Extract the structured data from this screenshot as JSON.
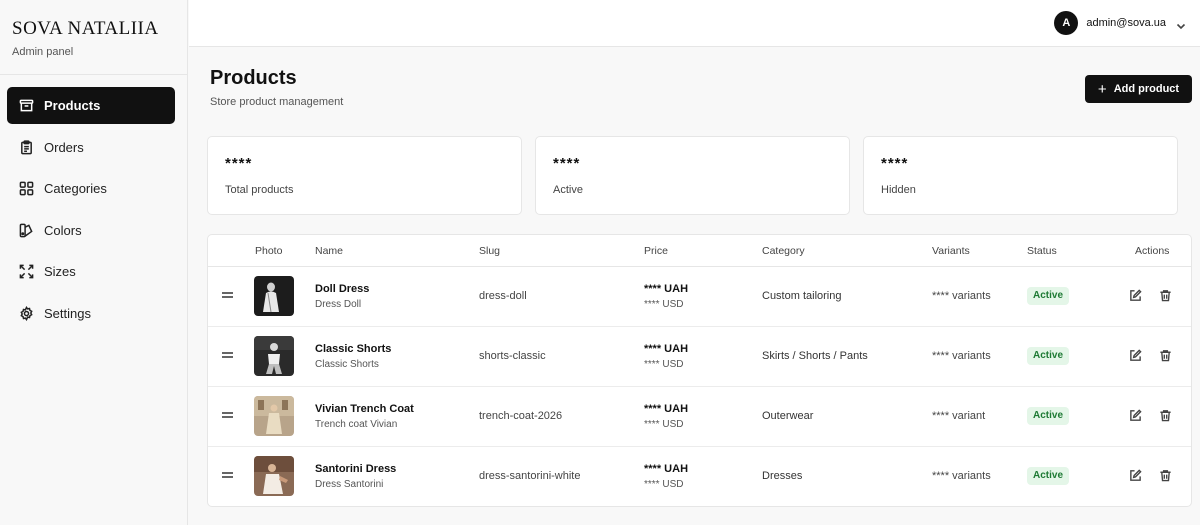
{
  "brand": {
    "title": "SOVA NATALIIA",
    "subtitle": "Admin panel"
  },
  "sidebar": {
    "items": [
      {
        "label": "Products",
        "icon": "archive-icon",
        "active": true
      },
      {
        "label": "Orders",
        "icon": "clipboard-icon",
        "active": false
      },
      {
        "label": "Categories",
        "icon": "grid-icon",
        "active": false
      },
      {
        "label": "Colors",
        "icon": "palette-icon",
        "active": false
      },
      {
        "label": "Sizes",
        "icon": "expand-icon",
        "active": false
      },
      {
        "label": "Settings",
        "icon": "gear-icon",
        "active": false
      }
    ]
  },
  "topbar": {
    "avatar_initial": "A",
    "email": "admin@sova.ua"
  },
  "header": {
    "title": "Products",
    "subtitle": "Store product management",
    "add_label": "Add product"
  },
  "stats": [
    {
      "value": "****",
      "label": "Total products"
    },
    {
      "value": "****",
      "label": "Active"
    },
    {
      "value": "****",
      "label": "Hidden"
    }
  ],
  "table": {
    "columns": [
      "Photo",
      "Name",
      "Slug",
      "Price",
      "Category",
      "Variants",
      "Status",
      "Actions"
    ],
    "rows": [
      {
        "name": "Doll Dress",
        "subname": "Dress Doll",
        "slug": "dress-doll",
        "price_uah": "**** UAH",
        "price_usd": "**** USD",
        "category": "Custom tailoring",
        "variants": "**** variants",
        "status": "Active"
      },
      {
        "name": "Classic Shorts",
        "subname": "Classic Shorts",
        "slug": "shorts-classic",
        "price_uah": "**** UAH",
        "price_usd": "**** USD",
        "category": "Skirts / Shorts / Pants",
        "variants": "**** variants",
        "status": "Active"
      },
      {
        "name": "Vivian Trench Coat",
        "subname": "Trench coat Vivian",
        "slug": "trench-coat-2026",
        "price_uah": "**** UAH",
        "price_usd": "**** USD",
        "category": "Outerwear",
        "variants": "**** variant",
        "status": "Active"
      },
      {
        "name": "Santorini Dress",
        "subname": "Dress Santorini",
        "slug": "dress-santorini-white",
        "price_uah": "**** UAH",
        "price_usd": "**** USD",
        "category": "Dresses",
        "variants": "**** variants",
        "status": "Active"
      }
    ]
  },
  "colors": {
    "accent": "#111111",
    "status_bg": "#e4f6e8",
    "status_text": "#1e7a34"
  }
}
